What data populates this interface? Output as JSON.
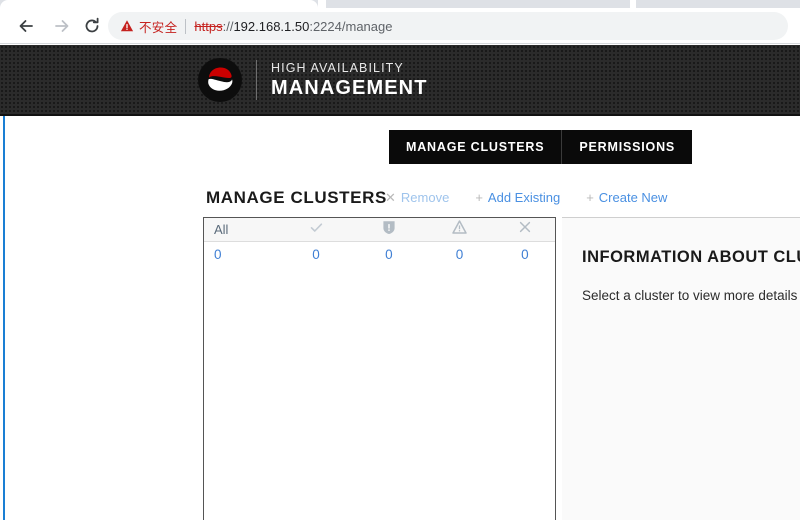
{
  "browser": {
    "back_icon": "back-arrow-icon",
    "forward_icon": "forward-arrow-icon",
    "reload_icon": "reload-icon",
    "security_icon": "warning-triangle-icon",
    "security_label": "不安全",
    "url_scheme": "https",
    "url_separator": "://",
    "url_host": "192.168.1.50",
    "url_rest": ":2224/manage",
    "url_full": "https://192.168.1.50:2224/manage",
    "colors": {
      "insecure_red": "#c5221f",
      "omnibox_bg": "#f1f3f4",
      "tabstrip_bg": "#dee1e6"
    }
  },
  "header": {
    "logo_icon": "red-hat-shadowman-logo",
    "brand_line1": "HIGH AVAILABILITY",
    "brand_line2": "MANAGEMENT",
    "tabs": [
      {
        "label": "MANAGE CLUSTERS",
        "active": true
      },
      {
        "label": "PERMISSIONS",
        "active": false
      }
    ],
    "colors": {
      "header_bg": "#2b2b2b",
      "tab_bg": "#0a0a0a",
      "accent_red": "#cc0000"
    }
  },
  "toolbar": {
    "title": "MANAGE CLUSTERS",
    "actions": [
      {
        "glyph": "✕",
        "icon": "close-x-icon",
        "label": "Remove",
        "enabled": false
      },
      {
        "glyph": "+",
        "icon": "plus-icon",
        "label": "Add Existing",
        "enabled": true
      },
      {
        "glyph": "+",
        "icon": "plus-icon",
        "label": "Create New",
        "enabled": true
      }
    ],
    "link_color": "#4a90e2"
  },
  "cluster_list": {
    "columns": [
      {
        "key": "all",
        "label": "All",
        "icon": null
      },
      {
        "key": "ok",
        "label": "",
        "icon": "check-icon"
      },
      {
        "key": "shield",
        "label": "",
        "icon": "shield-exclamation-icon"
      },
      {
        "key": "warning",
        "label": "",
        "icon": "warning-triangle-icon"
      },
      {
        "key": "error",
        "label": "",
        "icon": "close-x-icon"
      }
    ],
    "counts": [
      "0",
      "0",
      "0",
      "0",
      "0"
    ],
    "rows": [],
    "count_color": "#3f7fd4"
  },
  "info_panel": {
    "title": "INFORMATION ABOUT CLUSTER",
    "subtitle": "Select a cluster to view more details"
  },
  "page_accent": {
    "left_edge_color": "#1a7fd4"
  }
}
